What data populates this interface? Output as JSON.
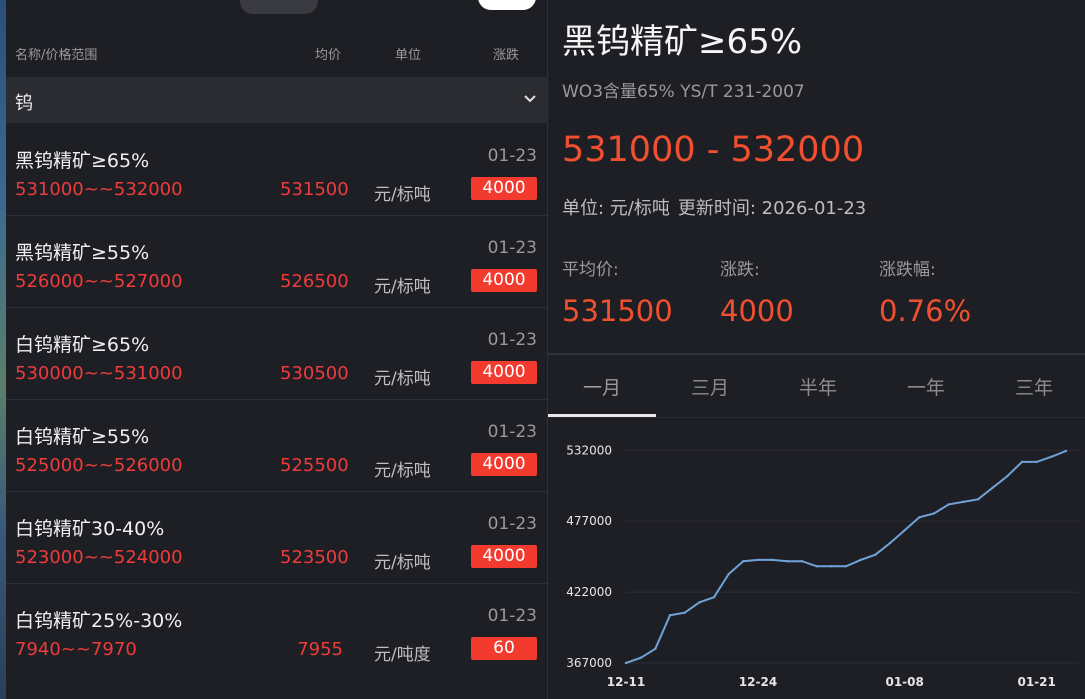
{
  "nav": {
    "brand": "",
    "items": [
      "",
      "",
      "",
      "",
      ""
    ],
    "active_index": 2
  },
  "list_header": {
    "name": "名称/价格范围",
    "avg": "均价",
    "unit": "单位",
    "change": "涨跌"
  },
  "category": {
    "label": "钨",
    "icon": "chevron-down-icon"
  },
  "rows": [
    {
      "name": "黑钨精矿≥65%",
      "date": "01-23",
      "range": "531000~~532000",
      "avg": "531500",
      "unit": "元/标吨",
      "change": "4000"
    },
    {
      "name": "黑钨精矿≥55%",
      "date": "01-23",
      "range": "526000~~527000",
      "avg": "526500",
      "unit": "元/标吨",
      "change": "4000"
    },
    {
      "name": "白钨精矿≥65%",
      "date": "01-23",
      "range": "530000~~531000",
      "avg": "530500",
      "unit": "元/标吨",
      "change": "4000"
    },
    {
      "name": "白钨精矿≥55%",
      "date": "01-23",
      "range": "525000~~526000",
      "avg": "525500",
      "unit": "元/标吨",
      "change": "4000"
    },
    {
      "name": "白钨精矿30-40%",
      "date": "01-23",
      "range": "523000~~524000",
      "avg": "523500",
      "unit": "元/标吨",
      "change": "4000"
    },
    {
      "name": "白钨精矿25%-30%",
      "date": "01-23",
      "range": "7940~~7970",
      "avg": "7955",
      "unit": "元/吨度",
      "change": "60"
    }
  ],
  "detail": {
    "title": "黑钨精矿≥65%",
    "subtitle": "WO3含量65% YS/T 231-2007",
    "price_range": "531000 - 532000",
    "unit_text": "单位: 元/标吨",
    "update_text": "更新时间: 2026-01-23",
    "stats": [
      {
        "label": "平均价:",
        "value": "531500"
      },
      {
        "label": "涨跌:",
        "value": "4000"
      },
      {
        "label": "涨跌幅:",
        "value": "0.76%"
      }
    ],
    "tabs": [
      "一月",
      "三月",
      "半年",
      "一年",
      "三年"
    ],
    "active_tab": 0
  },
  "colors": {
    "accent_red": "#f0502f",
    "badge_red": "#f23a2e",
    "line": "#6fa3d8"
  },
  "chart_data": {
    "type": "line",
    "x_ticks": [
      "12-11",
      "12-24",
      "01-08",
      "01-21"
    ],
    "y_ticks": [
      367000,
      422000,
      477000,
      532000
    ],
    "ylim": [
      360000,
      540000
    ],
    "grid": true,
    "series": [
      {
        "x": [
          "12-11",
          "12-12",
          "12-15",
          "12-16",
          "12-17",
          "12-18",
          "12-19",
          "12-22",
          "12-23",
          "12-24",
          "12-25",
          "12-26",
          "12-29",
          "12-30",
          "12-31",
          "01-02",
          "01-05",
          "01-06",
          "01-07",
          "01-08",
          "01-09",
          "01-12",
          "01-13",
          "01-14",
          "01-15",
          "01-16",
          "01-19",
          "01-20",
          "01-21",
          "01-22",
          "01-23"
        ],
        "values": [
          367000,
          371000,
          378000,
          404000,
          406000,
          414000,
          418000,
          436000,
          446000,
          447000,
          447000,
          446000,
          446000,
          442000,
          442000,
          442000,
          447000,
          451000,
          460000,
          470000,
          480000,
          483000,
          490000,
          492000,
          494000,
          503000,
          512000,
          523000,
          523000,
          527000,
          531500
        ]
      }
    ]
  }
}
